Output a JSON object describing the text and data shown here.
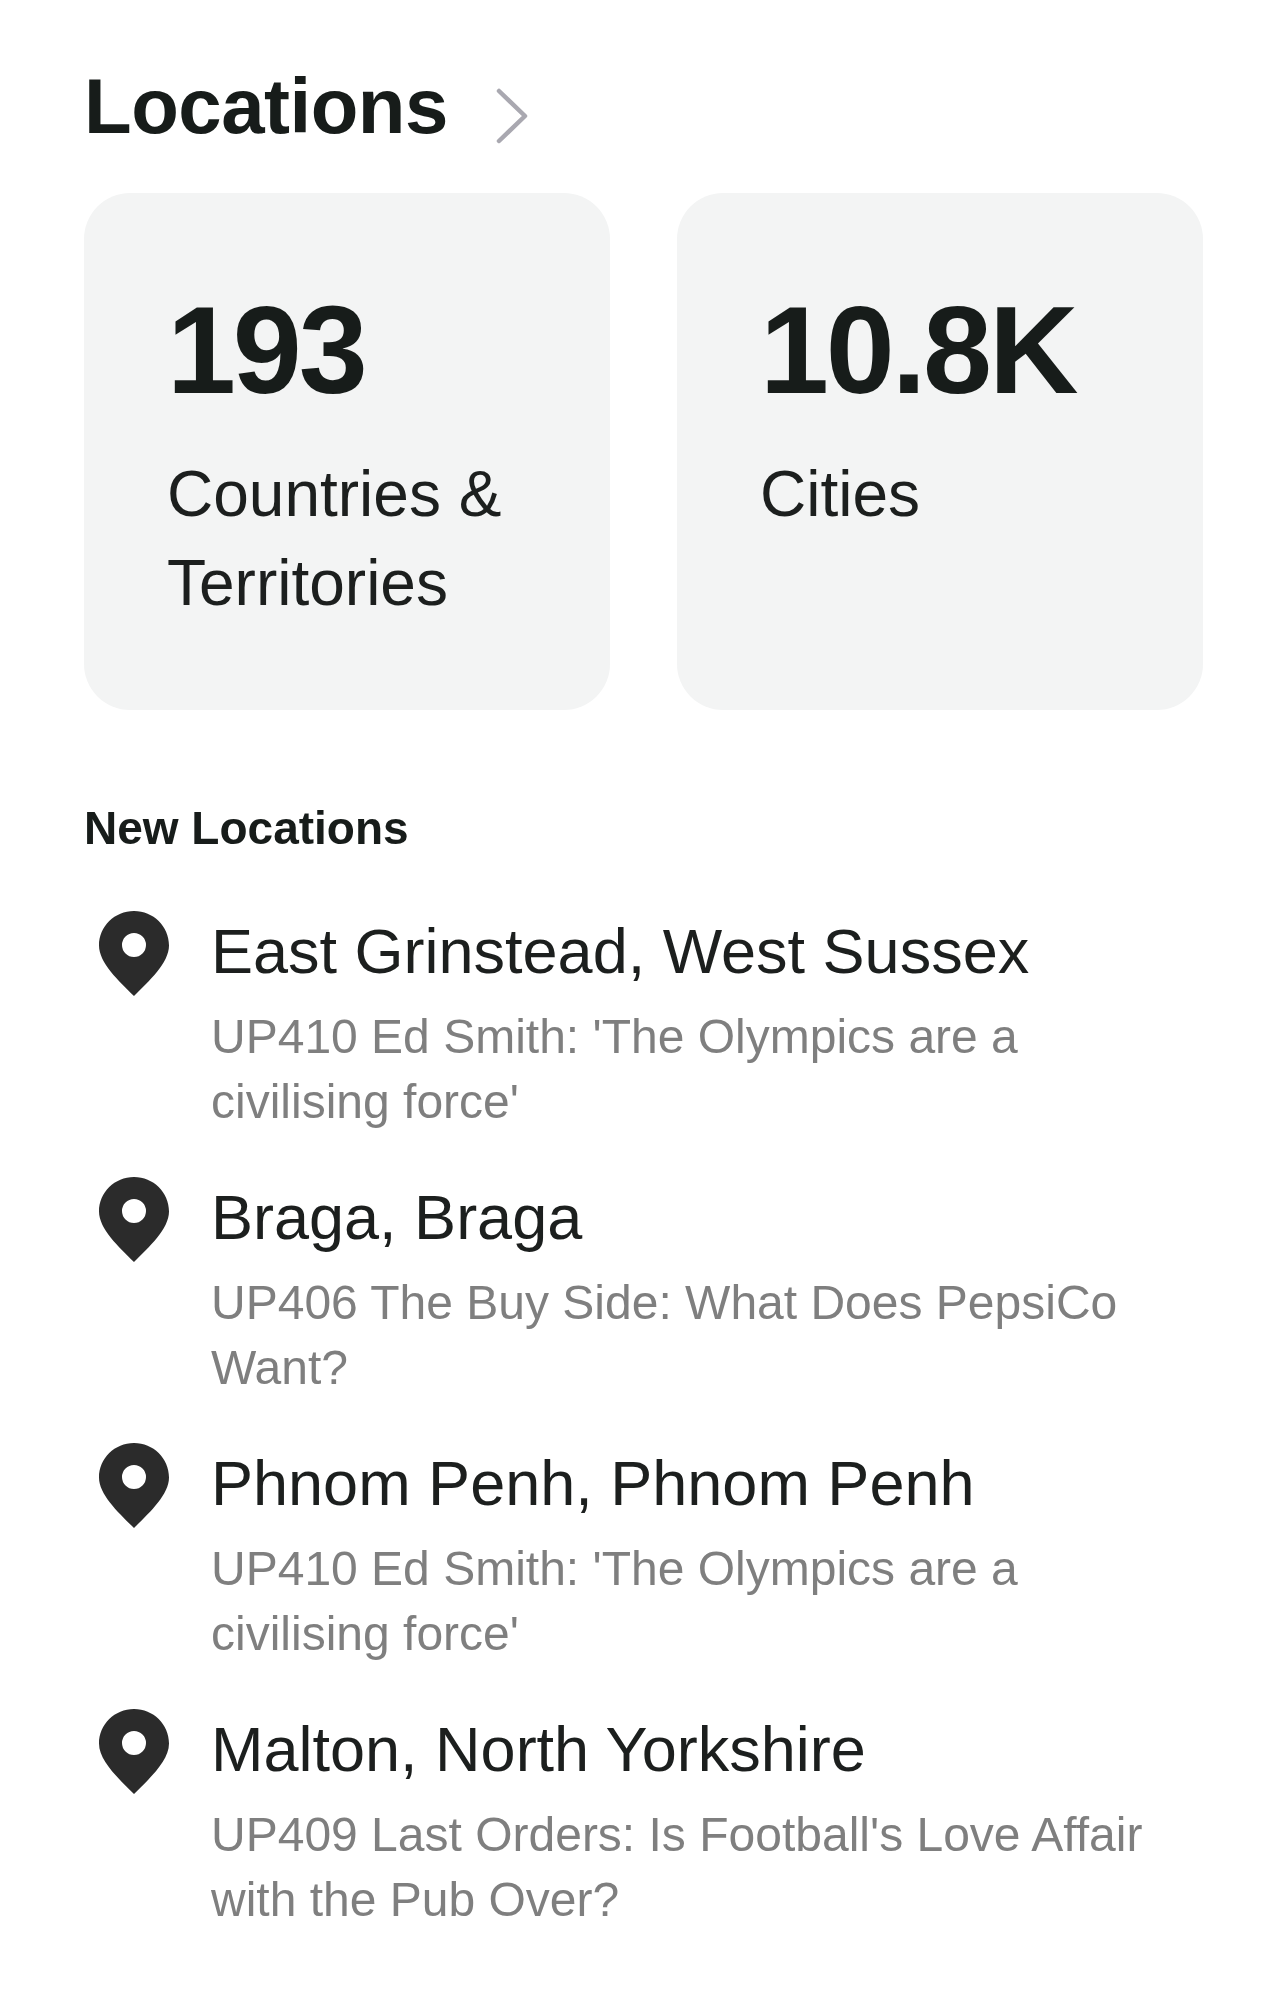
{
  "header": {
    "title": "Locations"
  },
  "stats": [
    {
      "value": "193",
      "label": "Countries & Territories"
    },
    {
      "value": "10.8K",
      "label": "Cities"
    }
  ],
  "new_locations": {
    "heading": "New Locations",
    "items": [
      {
        "name": "East Grinstead, West Sussex",
        "subtitle": "UP410 Ed Smith: 'The Olympics are a civilising force'"
      },
      {
        "name": "Braga, Braga",
        "subtitle": "UP406 The Buy Side: What Does PepsiCo Want?"
      },
      {
        "name": "Phnom Penh, Phnom Penh",
        "subtitle": "UP410 Ed Smith: 'The Olympics are a civilising force'"
      },
      {
        "name": "Malton, North Yorkshire",
        "subtitle": "UP409 Last Orders: Is Football's Love Affair with the Pub Over?"
      }
    ]
  }
}
